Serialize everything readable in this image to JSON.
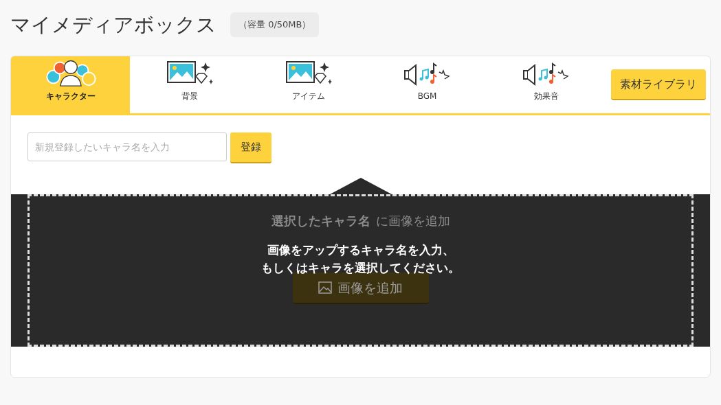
{
  "page": {
    "title": "マイメディアボックス",
    "capacity": "（容量 0/50MB）"
  },
  "tabs": [
    {
      "label": "キャラクター",
      "kind": "character",
      "selected": true
    },
    {
      "label": "背景",
      "kind": "image",
      "selected": false
    },
    {
      "label": "アイテム",
      "kind": "image",
      "selected": false
    },
    {
      "label": "BGM",
      "kind": "sound",
      "selected": false
    },
    {
      "label": "効果音",
      "kind": "sound",
      "selected": false
    }
  ],
  "library_button": "素材ライブラリ",
  "register": {
    "placeholder": "新規登録したいキャラ名を入力",
    "button": "登録"
  },
  "drop_area": {
    "target": "選択したキャラ名",
    "heading_rest": "に画像を追加",
    "button": "画像を追加"
  },
  "overlay": {
    "message": [
      "画像をアップするキャラ名を入力、",
      "もしくはキャラを選択してください。"
    ]
  }
}
